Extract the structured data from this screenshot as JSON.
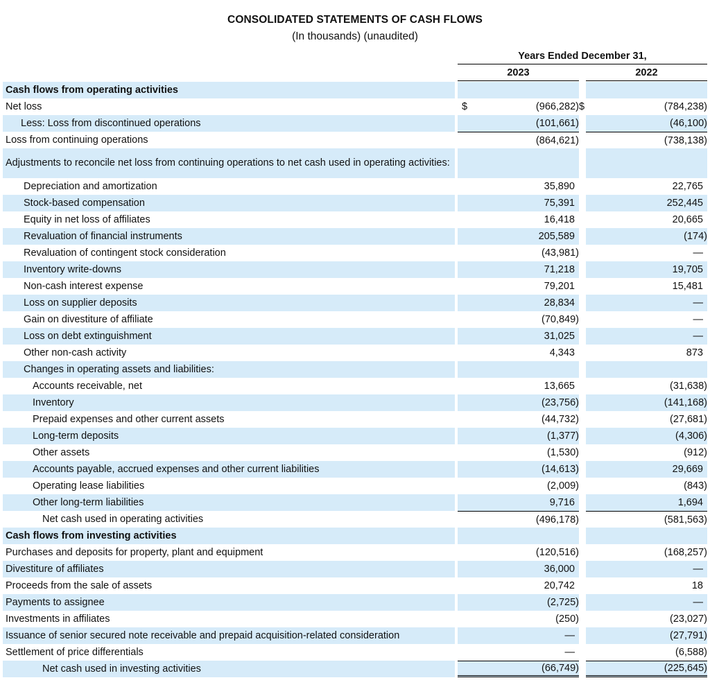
{
  "title": "CONSOLIDATED STATEMENTS OF CASH FLOWS",
  "subtitle": "(In thousands) (unaudited)",
  "header": {
    "period_label": "Years Ended December 31,",
    "year_1": "2023",
    "year_2": "2022"
  },
  "currency_symbol": "$",
  "rows": [
    {
      "label": "Cash flows from operating activities",
      "v2023": "",
      "v2022": "",
      "bold": true,
      "indent": 0,
      "shade": true,
      "h": 24
    },
    {
      "label": "Net loss",
      "v2023": "(966,282)",
      "v2022": "(784,238)",
      "dollar": true,
      "indent": 0,
      "shade": false,
      "h": 24
    },
    {
      "label": "Less: Loss from discontinued operations",
      "v2023": "(101,661)",
      "v2022": "(46,100)",
      "indent": 1,
      "shade": true,
      "h": 24
    },
    {
      "label": "Loss from continuing operations",
      "v2023": "(864,621)",
      "v2022": "(738,138)",
      "indent": 0,
      "shade": false,
      "h": 24,
      "top_border": true
    },
    {
      "label": "Adjustments to reconcile net loss from continuing operations to net cash used in operating activities:",
      "v2023": "",
      "v2022": "",
      "indent": 0,
      "shade": true,
      "h": 43
    },
    {
      "label": "Depreciation and amortization",
      "v2023": "35,890",
      "v2022": "22,765",
      "indent": 2,
      "shade": false,
      "h": 24
    },
    {
      "label": "Stock-based compensation",
      "v2023": "75,391",
      "v2022": "252,445",
      "indent": 2,
      "shade": true,
      "h": 24
    },
    {
      "label": "Equity in net loss of affiliates",
      "v2023": "16,418",
      "v2022": "20,665",
      "indent": 2,
      "shade": false,
      "h": 24
    },
    {
      "label": "Revaluation of financial instruments",
      "v2023": "205,589",
      "v2022": "(174)",
      "indent": 2,
      "shade": true,
      "h": 24
    },
    {
      "label": "Revaluation of contingent stock consideration",
      "v2023": "(43,981)",
      "v2022": "—",
      "indent": 2,
      "shade": false,
      "h": 24
    },
    {
      "label": "Inventory write-downs",
      "v2023": "71,218",
      "v2022": "19,705",
      "indent": 2,
      "shade": true,
      "h": 24
    },
    {
      "label": "Non-cash interest expense",
      "v2023": "79,201",
      "v2022": "15,481",
      "indent": 2,
      "shade": false,
      "h": 24
    },
    {
      "label": "Loss on supplier deposits",
      "v2023": "28,834",
      "v2022": "—",
      "indent": 2,
      "shade": true,
      "h": 24
    },
    {
      "label": "Gain on divestiture of affiliate",
      "v2023": "(70,849)",
      "v2022": "—",
      "indent": 2,
      "shade": false,
      "h": 24
    },
    {
      "label": "Loss on debt extinguishment",
      "v2023": "31,025",
      "v2022": "—",
      "indent": 2,
      "shade": true,
      "h": 24
    },
    {
      "label": "Other non-cash activity",
      "v2023": "4,343",
      "v2022": "873",
      "indent": 2,
      "shade": false,
      "h": 24
    },
    {
      "label": "Changes in operating assets and liabilities:",
      "v2023": "",
      "v2022": "",
      "indent": 2,
      "shade": true,
      "h": 24
    },
    {
      "label": "Accounts receivable, net",
      "v2023": "13,665",
      "v2022": "(31,638)",
      "indent": 3,
      "shade": false,
      "h": 24
    },
    {
      "label": "Inventory",
      "v2023": "(23,756)",
      "v2022": "(141,168)",
      "indent": 3,
      "shade": true,
      "h": 24
    },
    {
      "label": "Prepaid expenses and other current assets",
      "v2023": "(44,732)",
      "v2022": "(27,681)",
      "indent": 3,
      "shade": false,
      "h": 24
    },
    {
      "label": "Long-term deposits",
      "v2023": "(1,377)",
      "v2022": "(4,306)",
      "indent": 3,
      "shade": true,
      "h": 24
    },
    {
      "label": "Other assets",
      "v2023": "(1,530)",
      "v2022": "(912)",
      "indent": 3,
      "shade": false,
      "h": 24
    },
    {
      "label": "Accounts payable, accrued expenses and other current liabilities",
      "v2023": "(14,613)",
      "v2022": "29,669",
      "indent": 3,
      "shade": true,
      "h": 24
    },
    {
      "label": "Operating lease liabilities",
      "v2023": "(2,009)",
      "v2022": "(843)",
      "indent": 3,
      "shade": false,
      "h": 24
    },
    {
      "label": "Other long-term liabilities",
      "v2023": "9,716",
      "v2022": "1,694",
      "indent": 3,
      "shade": true,
      "h": 24
    },
    {
      "label": "Net cash used in operating activities",
      "v2023": "(496,178)",
      "v2022": "(581,563)",
      "indent": 4,
      "shade": false,
      "h": 24,
      "top_border": true
    },
    {
      "label": "Cash flows from investing activities",
      "v2023": "",
      "v2022": "",
      "bold": true,
      "indent": 0,
      "shade": true,
      "h": 24
    },
    {
      "label": "Purchases and deposits for property, plant and equipment",
      "v2023": "(120,516)",
      "v2022": "(168,257)",
      "indent": 0,
      "shade": false,
      "h": 24
    },
    {
      "label": "Divestiture of affiliates",
      "v2023": "36,000",
      "v2022": "—",
      "indent": 0,
      "shade": true,
      "h": 24
    },
    {
      "label": "Proceeds from the sale of assets",
      "v2023": "20,742",
      "v2022": "18",
      "indent": 0,
      "shade": false,
      "h": 24
    },
    {
      "label": "Payments to assignee",
      "v2023": "(2,725)",
      "v2022": "—",
      "indent": 0,
      "shade": true,
      "h": 24
    },
    {
      "label": "Investments in affiliates",
      "v2023": "(250)",
      "v2022": "(23,027)",
      "indent": 0,
      "shade": false,
      "h": 24
    },
    {
      "label": "Issuance of senior secured note receivable and prepaid acquisition-related consideration",
      "v2023": "—",
      "v2022": "(27,791)",
      "indent": 0,
      "shade": true,
      "h": 24
    },
    {
      "label": "Settlement of price differentials",
      "v2023": "—",
      "v2022": "(6,588)",
      "indent": 0,
      "shade": false,
      "h": 24
    },
    {
      "label": "Net cash used in investing activities",
      "v2023": "(66,749)",
      "v2022": "(225,645)",
      "indent": 4,
      "shade": true,
      "h": 24,
      "top_border": true,
      "double_bottom": true
    }
  ],
  "colors": {
    "row_shade": "#d6ebf9",
    "text": "#111111"
  }
}
